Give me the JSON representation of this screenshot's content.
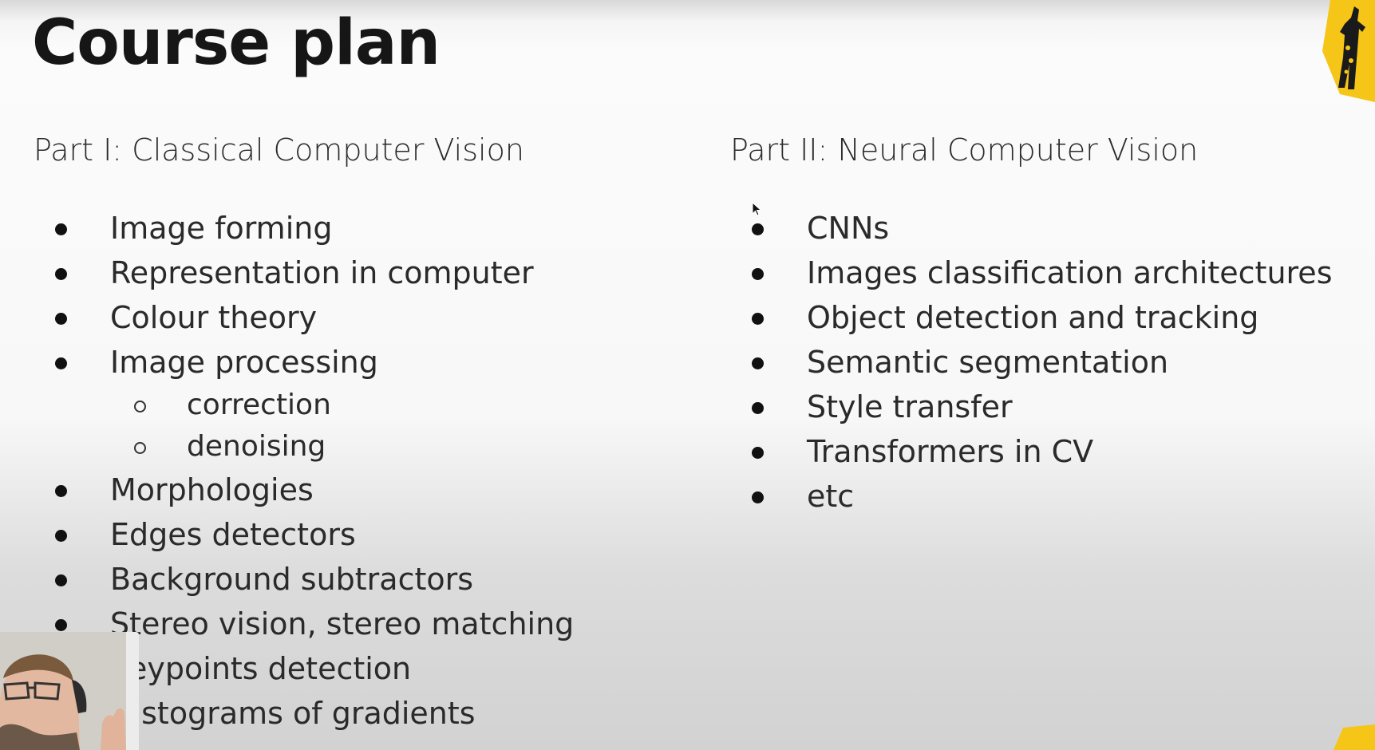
{
  "slide": {
    "title": "Course plan",
    "left_column": {
      "heading": "Part I: Classical Computer Vision",
      "items": [
        {
          "label": "Image forming",
          "level": 1
        },
        {
          "label": "Representation in computer",
          "level": 1
        },
        {
          "label": "Colour theory",
          "level": 1
        },
        {
          "label": "Image processing",
          "level": 1
        },
        {
          "label": "correction",
          "level": 2
        },
        {
          "label": "denoising",
          "level": 2
        },
        {
          "label": "Morphologies",
          "level": 1
        },
        {
          "label": "Edges detectors",
          "level": 1
        },
        {
          "label": "Background subtractors",
          "level": 1
        },
        {
          "label": "Stereo vision, stereo matching",
          "level": 1
        },
        {
          "label": "Keypoints detection",
          "level": 1
        },
        {
          "label": "Histograms of gradients",
          "level": 1
        }
      ]
    },
    "right_column": {
      "heading": "Part II: Neural Computer Vision",
      "items": [
        {
          "label": "CNNs",
          "level": 1
        },
        {
          "label": "Images classification architectures",
          "level": 1
        },
        {
          "label": "Object detection and tracking",
          "level": 1
        },
        {
          "label": "Semantic segmentation",
          "level": 1
        },
        {
          "label": "Style transfer",
          "level": 1
        },
        {
          "label": "Transformers in CV",
          "level": 1
        },
        {
          "label": "etc",
          "level": 1
        }
      ]
    }
  },
  "colors": {
    "text": "#2a2a2a",
    "title": "#161616",
    "logo_yellow": "#f5c518",
    "logo_dark": "#1a1a1a"
  },
  "icons": {
    "logo": "giraffe-logo-icon",
    "cursor": "mouse-pointer-icon",
    "bullet": "filled-circle-bullet",
    "sub_bullet": "hollow-circle-bullet"
  }
}
